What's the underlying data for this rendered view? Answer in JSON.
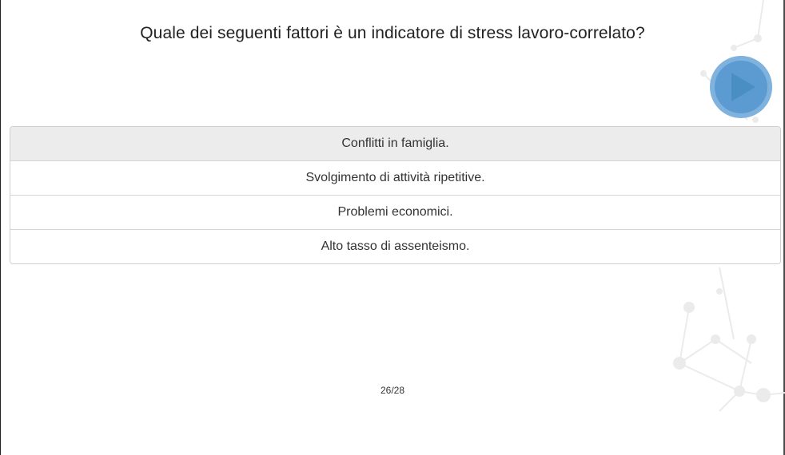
{
  "quiz": {
    "question": "Quale dei seguenti fattori è un indicatore di stress lavoro-correlato?",
    "answers": [
      {
        "label": "Conflitti in famiglia."
      },
      {
        "label": "Svolgimento di attività ripetitive."
      },
      {
        "label": "Problemi economici."
      },
      {
        "label": "Alto tasso di assenteismo."
      }
    ],
    "progress": "26/28"
  },
  "icons": {
    "play": "play-icon"
  },
  "colors": {
    "play_outer": "#7fb2dc",
    "play_inner": "#5b9bd1",
    "play_triangle": "#4a8fc4",
    "highlight_row": "#ececec",
    "border": "#cfcfcf"
  }
}
